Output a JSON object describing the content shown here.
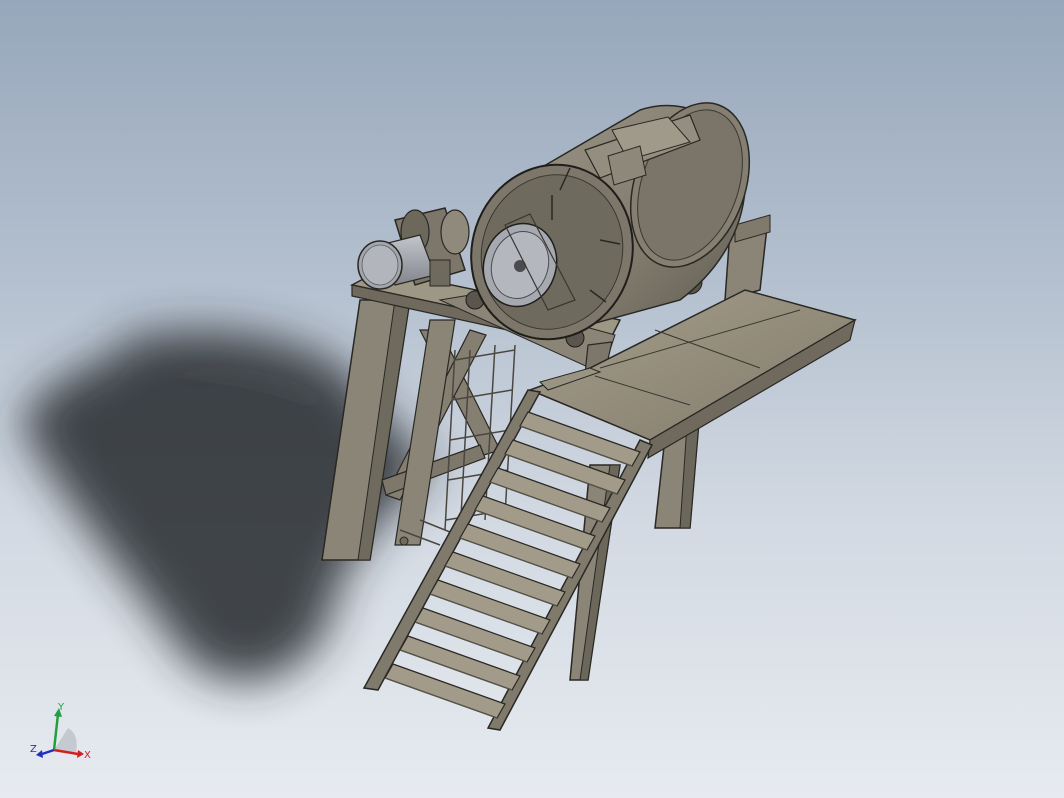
{
  "viewport": {
    "background_top": "#97a7bb",
    "background_bottom": "#e7ebf0"
  },
  "model": {
    "steel_color": "#8a8577",
    "steel_dark": "#5e5a50",
    "drum_color": "#7f7a6c",
    "motor_color": "#a3a6ad",
    "shadow_color": "#2a2e33"
  },
  "triad": {
    "x_label": "X",
    "y_label": "Y",
    "z_label": "Z",
    "x_color": "#d02020",
    "y_color": "#20a040",
    "z_color": "#2030c0"
  }
}
